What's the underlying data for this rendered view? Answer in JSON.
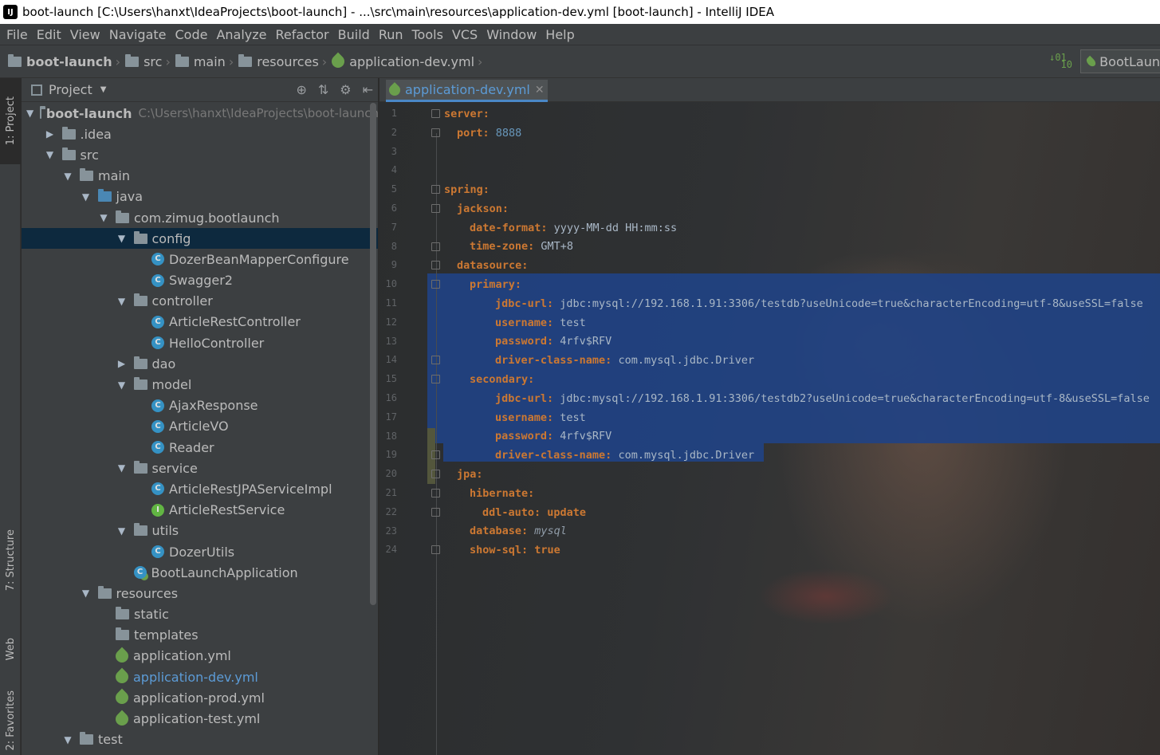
{
  "window": {
    "title": "boot-launch [C:\\Users\\hanxt\\IdeaProjects\\boot-launch] - ...\\src\\main\\resources\\application-dev.yml [boot-launch] - IntelliJ IDEA"
  },
  "menu": [
    "File",
    "Edit",
    "View",
    "Navigate",
    "Code",
    "Analyze",
    "Refactor",
    "Build",
    "Run",
    "Tools",
    "VCS",
    "Window",
    "Help"
  ],
  "breadcrumb": [
    "boot-launch",
    "src",
    "main",
    "resources",
    "application-dev.yml"
  ],
  "run_config": {
    "label": "BootLaun"
  },
  "left_stripe": {
    "project": "1: Project",
    "structure": "7: Structure",
    "web": "Web",
    "favorites": "2: Favorites"
  },
  "project_panel": {
    "title": "Project"
  },
  "tree": [
    {
      "label": "boot-launch",
      "path": "C:\\Users\\hanxt\\IdeaProjects\\boot-launch",
      "type": "project",
      "indent": 0,
      "arrow": "open"
    },
    {
      "label": ".idea",
      "type": "folder",
      "indent": 1,
      "arrow": "closed"
    },
    {
      "label": "src",
      "type": "folder",
      "indent": 1,
      "arrow": "open"
    },
    {
      "label": "main",
      "type": "folder",
      "indent": 2,
      "arrow": "open"
    },
    {
      "label": "java",
      "type": "folder-blue",
      "indent": 3,
      "arrow": "open"
    },
    {
      "label": "com.zimug.bootlaunch",
      "type": "package",
      "indent": 4,
      "arrow": "open"
    },
    {
      "label": "config",
      "type": "package",
      "indent": 5,
      "arrow": "open",
      "selected": true
    },
    {
      "label": "DozerBeanMapperConfigure",
      "type": "class",
      "indent": 6
    },
    {
      "label": "Swagger2",
      "type": "class",
      "indent": 6
    },
    {
      "label": "controller",
      "type": "package",
      "indent": 5,
      "arrow": "open"
    },
    {
      "label": "ArticleRestController",
      "type": "class",
      "indent": 6
    },
    {
      "label": "HelloController",
      "type": "class",
      "indent": 6
    },
    {
      "label": "dao",
      "type": "package",
      "indent": 5,
      "arrow": "closed"
    },
    {
      "label": "model",
      "type": "package",
      "indent": 5,
      "arrow": "open"
    },
    {
      "label": "AjaxResponse",
      "type": "class",
      "indent": 6
    },
    {
      "label": "ArticleVO",
      "type": "class",
      "indent": 6
    },
    {
      "label": "Reader",
      "type": "class",
      "indent": 6
    },
    {
      "label": "service",
      "type": "package",
      "indent": 5,
      "arrow": "open"
    },
    {
      "label": "ArticleRestJPAServiceImpl",
      "type": "class",
      "indent": 6
    },
    {
      "label": "ArticleRestService",
      "type": "interface",
      "indent": 6
    },
    {
      "label": "utils",
      "type": "package",
      "indent": 5,
      "arrow": "open"
    },
    {
      "label": "DozerUtils",
      "type": "class",
      "indent": 6
    },
    {
      "label": "BootLaunchApplication",
      "type": "app",
      "indent": 5
    },
    {
      "label": "resources",
      "type": "folder-res",
      "indent": 3,
      "arrow": "open"
    },
    {
      "label": "static",
      "type": "folder",
      "indent": 4
    },
    {
      "label": "templates",
      "type": "folder",
      "indent": 4
    },
    {
      "label": "application.yml",
      "type": "yml",
      "indent": 4
    },
    {
      "label": "application-dev.yml",
      "type": "yml",
      "indent": 4,
      "link": true
    },
    {
      "label": "application-prod.yml",
      "type": "yml",
      "indent": 4
    },
    {
      "label": "application-test.yml",
      "type": "yml",
      "indent": 4
    },
    {
      "label": "test",
      "type": "folder",
      "indent": 2,
      "arrow": "open"
    }
  ],
  "editor": {
    "tab": "application-dev.yml",
    "lines": [
      {
        "n": "1",
        "indent": 0,
        "key": "server:",
        "val": "",
        "vtype": ""
      },
      {
        "n": "2",
        "indent": 1,
        "key": "port:",
        "val": " 8888",
        "vtype": "num"
      },
      {
        "n": "3",
        "indent": 0,
        "key": "",
        "val": "",
        "vtype": ""
      },
      {
        "n": "4",
        "indent": 0,
        "key": "",
        "val": "",
        "vtype": ""
      },
      {
        "n": "5",
        "indent": 0,
        "key": "spring:",
        "val": "",
        "vtype": ""
      },
      {
        "n": "6",
        "indent": 1,
        "key": "jackson:",
        "val": "",
        "vtype": ""
      },
      {
        "n": "7",
        "indent": 2,
        "key": "date-format:",
        "val": " yyyy-MM-dd HH:mm:ss",
        "vtype": "str"
      },
      {
        "n": "8",
        "indent": 2,
        "key": "time-zone:",
        "val": " GMT+8",
        "vtype": "str"
      },
      {
        "n": "9",
        "indent": 1,
        "key": "datasource:",
        "val": "",
        "vtype": ""
      },
      {
        "n": "10",
        "indent": 2,
        "key": "primary:",
        "val": "",
        "vtype": ""
      },
      {
        "n": "11",
        "indent": 4,
        "key": "jdbc-url:",
        "val": " jdbc:mysql://192.168.1.91:3306/testdb?useUnicode=true&characterEncoding=utf-8&useSSL=false",
        "vtype": "str"
      },
      {
        "n": "12",
        "indent": 4,
        "key": "username:",
        "val": " test",
        "vtype": "str"
      },
      {
        "n": "13",
        "indent": 4,
        "key": "password:",
        "val": " 4rfv$RFV",
        "vtype": "str"
      },
      {
        "n": "14",
        "indent": 4,
        "key": "driver-class-name:",
        "val": " com.mysql.jdbc.Driver",
        "vtype": "str"
      },
      {
        "n": "15",
        "indent": 2,
        "key": "secondary:",
        "val": "",
        "vtype": ""
      },
      {
        "n": "16",
        "indent": 4,
        "key": "jdbc-url:",
        "val": " jdbc:mysql://192.168.1.91:3306/testdb2?useUnicode=true&characterEncoding=utf-8&useSSL=false",
        "vtype": "str"
      },
      {
        "n": "17",
        "indent": 4,
        "key": "username:",
        "val": " test",
        "vtype": "str"
      },
      {
        "n": "18",
        "indent": 4,
        "key": "password:",
        "val": " 4rfv$RFV",
        "vtype": "str"
      },
      {
        "n": "19",
        "indent": 4,
        "key": "driver-class-name:",
        "val": " com.mysql.jdbc.Driver",
        "vtype": "str"
      },
      {
        "n": "20",
        "indent": 1,
        "key": "jpa:",
        "val": "",
        "vtype": ""
      },
      {
        "n": "21",
        "indent": 2,
        "key": "hibernate:",
        "val": "",
        "vtype": ""
      },
      {
        "n": "22",
        "indent": 3,
        "key": "ddl-auto:",
        "val": " update",
        "vtype": "kw"
      },
      {
        "n": "23",
        "indent": 2,
        "key": "database:",
        "val": " mysql",
        "vtype": "italic"
      },
      {
        "n": "24",
        "indent": 2,
        "key": "show-sql:",
        "val": " true",
        "vtype": "kw"
      }
    ]
  },
  "colors": {
    "accent": "#4a88c7",
    "selection": "#214283",
    "keyword": "#cc7832",
    "number": "#6897bb"
  }
}
